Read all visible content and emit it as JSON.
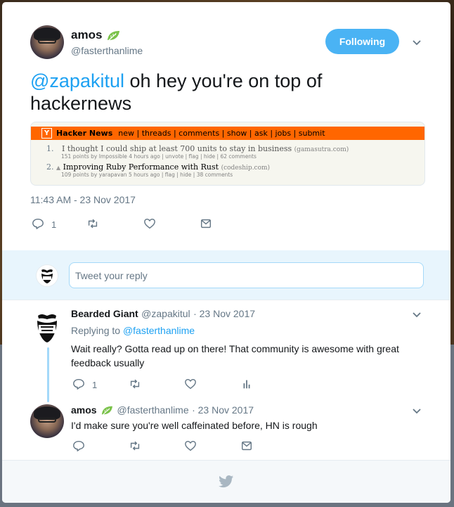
{
  "tweet": {
    "author_name": "amos",
    "author_handle": "@fasterthanlime",
    "follow_label": "Following",
    "mention": "@zapakitul",
    "text": " oh hey you're on top of hackernews",
    "timestamp": "11:43 AM - 23 Nov 2017",
    "reply_count": "1"
  },
  "hackernews": {
    "logo": "Y",
    "title": "Hacker News",
    "nav": "new | threads | comments | show | ask | jobs | submit",
    "items": [
      {
        "rank": "1.",
        "title": "I thought I could ship at least 700 units to stay in business",
        "site": "(gamasutra.com)",
        "meta": "151 points by Impossible 4 hours ago | unvote | flag | hide | 62 comments"
      },
      {
        "rank": "2.",
        "vote": "▲",
        "title": "Improving Ruby Performance with Rust",
        "site": "(codeship.com)",
        "meta": "109 points by yarapavan 5 hours ago | flag | hide | 38 comments"
      }
    ]
  },
  "composer": {
    "placeholder": "Tweet your reply"
  },
  "replies": [
    {
      "name": "Bearded Giant",
      "handle": "@zapakitul",
      "date": "· 23 Nov 2017",
      "replying_prefix": "Replying to ",
      "replying_to": "@fasterthanlime",
      "text": "Wait really? Gotta read up on there! That community is awesome with great feedback usually",
      "reply_count": "1"
    },
    {
      "name": "amos",
      "handle": "@fasterthanlime",
      "date": "· 23 Nov 2017",
      "text": "I'd make sure you're well caffeinated before, HN is rough"
    }
  ],
  "avatar_logo_text": "BEARDED GIANT",
  "colors": {
    "accent": "#1da1f2",
    "follow_button": "#4ab3f4",
    "hn_orange": "#ff6600",
    "leaf_green": "#7ac24a"
  },
  "icons": [
    "leaf-icon",
    "chevron-down-icon",
    "reply-icon",
    "retweet-icon",
    "like-icon",
    "direct-message-icon",
    "analytics-icon",
    "twitter-bird-icon"
  ]
}
